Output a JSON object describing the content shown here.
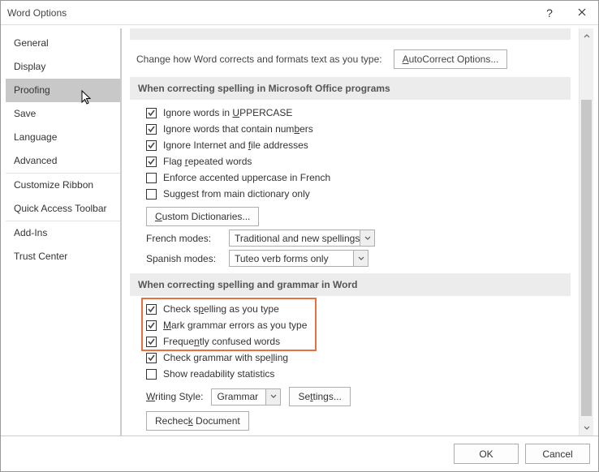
{
  "window": {
    "title": "Word Options"
  },
  "sidebar": {
    "items": [
      {
        "label": "General"
      },
      {
        "label": "Display"
      },
      {
        "label": "Proofing",
        "selected": true
      },
      {
        "label": "Save"
      },
      {
        "label": "Language"
      },
      {
        "label": "Advanced"
      },
      {
        "label": "Customize Ribbon",
        "sep": true
      },
      {
        "label": "Quick Access Toolbar"
      },
      {
        "label": "Add-Ins",
        "sep": true
      },
      {
        "label": "Trust Center"
      }
    ]
  },
  "top": {
    "desc": "Change how Word corrects and formats text as you type:",
    "autocorrect_btn": "AutoCorrect Options..."
  },
  "group1": {
    "heading": "When correcting spelling in Microsoft Office programs",
    "chk_uppercase": "Ignore words in UPPERCASE",
    "chk_numbers": "Ignore words that contain numbers",
    "chk_internet": "Ignore Internet and file addresses",
    "chk_repeat": "Flag repeated words",
    "chk_french_acc": "Enforce accented uppercase in French",
    "chk_maindict": "Suggest from main dictionary only",
    "custom_dict_btn": "Custom Dictionaries...",
    "french_label": "French modes:",
    "french_value": "Traditional and new spellings",
    "spanish_label": "Spanish modes:",
    "spanish_value": "Tuteo verb forms only"
  },
  "group2": {
    "heading": "When correcting spelling and grammar in Word",
    "chk_spell_type": "Check spelling as you type",
    "chk_grammar_type": "Mark grammar errors as you type",
    "chk_confused": "Frequently confused words",
    "chk_grammar_spell": "Check grammar with spelling",
    "chk_readability": "Show readability statistics",
    "writing_style_label": "Writing Style:",
    "writing_style_value": "Grammar",
    "settings_btn": "Settings...",
    "recheck_btn": "Recheck Document"
  },
  "footer": {
    "ok": "OK",
    "cancel": "Cancel"
  }
}
